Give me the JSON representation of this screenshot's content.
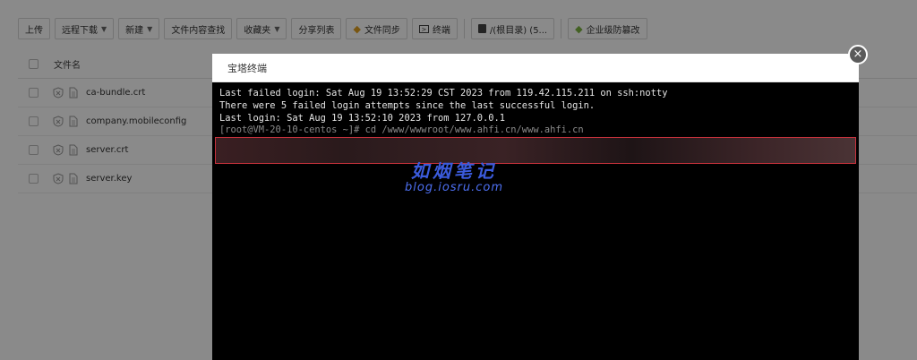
{
  "toolbar": {
    "upload": "上传",
    "remote_download": "远程下载",
    "new": "新建",
    "content_search": "文件内容查找",
    "favorites": "收藏夹",
    "share_list": "分享列表",
    "file_sync": "文件同步",
    "terminal": "终端",
    "root_dir": "/(根目录) (5...",
    "enterprise_tamper": "企业级防篡改"
  },
  "file_table": {
    "header_name": "文件名",
    "files": [
      {
        "name": "ca-bundle.crt"
      },
      {
        "name": "company.mobileconfig"
      },
      {
        "name": "server.crt"
      },
      {
        "name": "server.key"
      }
    ]
  },
  "icons": {
    "shield": "shield-icon",
    "file": "file-icon",
    "gem_yellow": "gem-icon",
    "terminal": "terminal-icon",
    "disk": "disk-icon",
    "gem_green": "gem-green-icon",
    "close": "close-icon"
  },
  "modal": {
    "title": "宝塔终端",
    "close": "×"
  },
  "terminal": {
    "lines": [
      "Last failed login: Sat Aug 19 13:52:29 CST 2023 from 119.42.115.211 on ssh:notty",
      "There were 5 failed login attempts since the last successful login.",
      "Last login: Sat Aug 19 13:52:10 2023 from 127.0.0.1"
    ],
    "prompt": "[root@VM-20-10-centos ~]# cd /www/wwwroot/www.ahfi.cn/www.ahfi.cn"
  },
  "watermark": {
    "cn": "如烟笔记",
    "en": "blog.iosru.com"
  },
  "colors": {
    "overlay": "#000000",
    "terminal_bg": "#000000",
    "redact_border": "#c8323c",
    "watermark": "#3b5bdc"
  }
}
